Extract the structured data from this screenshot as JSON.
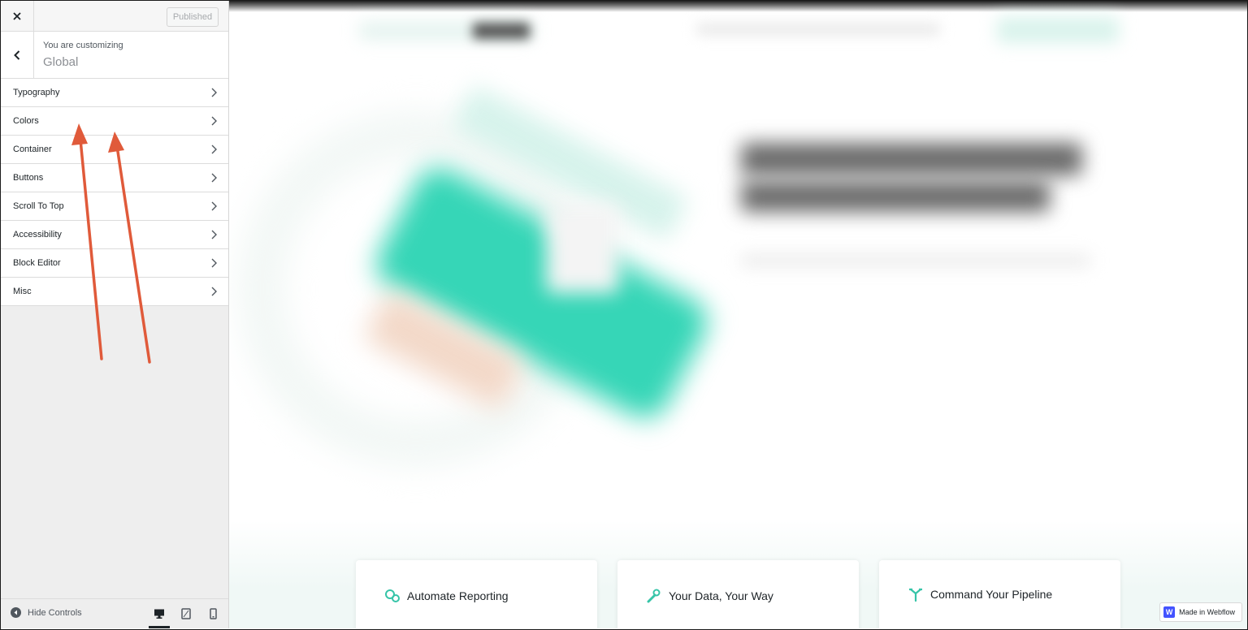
{
  "customizer": {
    "close_icon": "close-icon",
    "publish_label": "Published",
    "customizing_label": "You are customizing",
    "section_title": "Global",
    "menu": [
      {
        "label": "Typography"
      },
      {
        "label": "Colors"
      },
      {
        "label": "Container"
      },
      {
        "label": "Buttons"
      },
      {
        "label": "Scroll To Top"
      },
      {
        "label": "Accessibility"
      },
      {
        "label": "Block Editor"
      },
      {
        "label": "Misc"
      }
    ],
    "footer": {
      "hide_controls": "Hide Controls",
      "devices": [
        "desktop-icon",
        "tablet-icon",
        "mobile-icon"
      ],
      "active_device": "desktop"
    }
  },
  "preview": {
    "cards": [
      {
        "title": "Automate Reporting",
        "icon": "gears-icon"
      },
      {
        "title": "Your Data, Your Way",
        "icon": "wrench-icon"
      },
      {
        "title": "Command Your Pipeline",
        "icon": "branch-icon"
      }
    ],
    "badge": "Made in Webflow",
    "accent_color": "#36d6b7"
  },
  "annotation": {
    "arrow_color": "#e05a3a"
  }
}
